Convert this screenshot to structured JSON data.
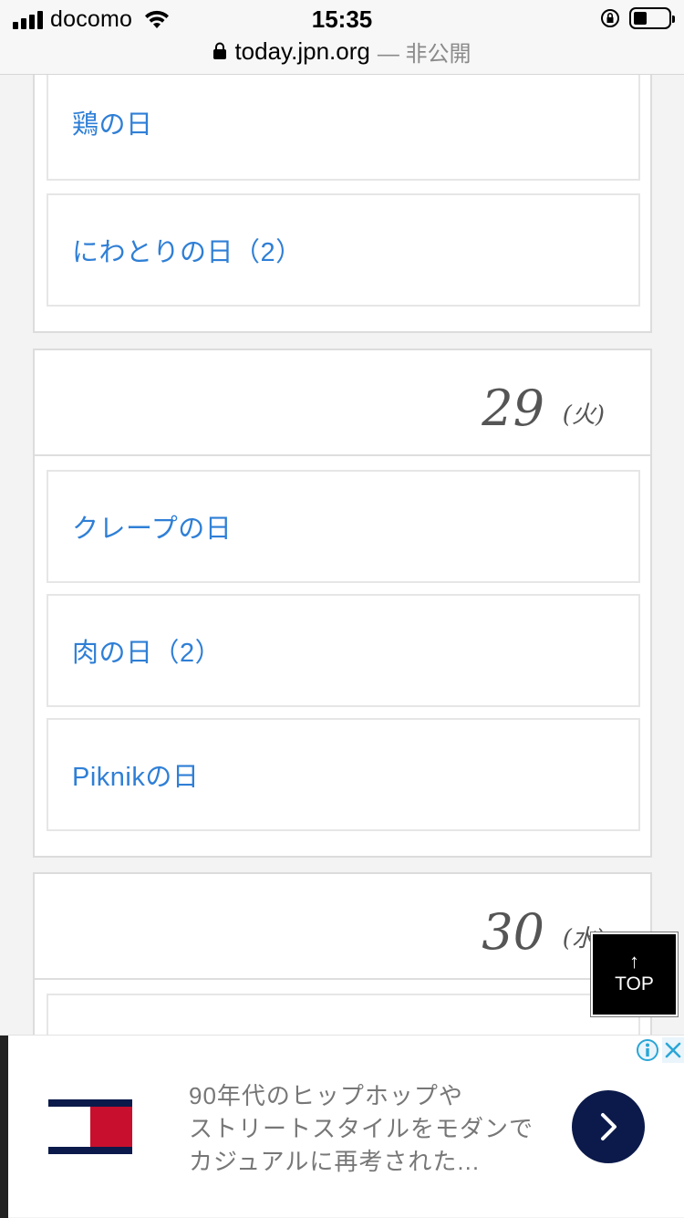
{
  "status": {
    "carrier": "docomo",
    "time": "15:35"
  },
  "url_bar": {
    "host": "today.jpn.org",
    "suffix": "— 非公開"
  },
  "days": [
    {
      "events": [
        "鶏の日",
        "にわとりの日（2）"
      ]
    },
    {
      "day": "29",
      "weekday": "(火)",
      "events": [
        "クレープの日",
        "肉の日（2）",
        "Piknikの日"
      ]
    },
    {
      "day": "30",
      "weekday": "(水)",
      "events": []
    }
  ],
  "top_button": {
    "arrow": "↑",
    "label": "TOP"
  },
  "ad": {
    "text_lines": [
      "90年代のヒップホップや",
      "ストリートスタイルをモダンで",
      "カジュアルに再考された..."
    ],
    "cta_icon": "chevron-right-icon",
    "brand_colors": {
      "navy": "#0b1a4a",
      "red": "#c8102e"
    }
  }
}
